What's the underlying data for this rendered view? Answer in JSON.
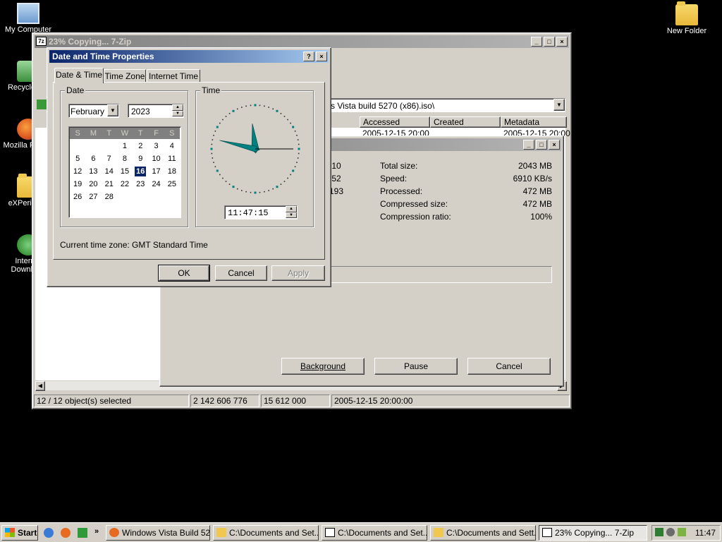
{
  "desktop": {
    "icons": [
      {
        "label": "My Computer"
      },
      {
        "label": "Recycle Bin"
      },
      {
        "label": "Mozilla Firefox"
      },
      {
        "label": "eXPerience"
      },
      {
        "label": "Internet Download"
      },
      {
        "label": "New Folder"
      }
    ]
  },
  "zip_window": {
    "title": "23% Copying... 7-Zip",
    "path": "s Vista build 5270 (x86).iso\\",
    "columns": [
      "Accessed",
      "Created",
      "Metadata Chan..."
    ],
    "row_partial": {
      "a": "2005-12-15 20:00",
      "m": "2005-12-15 20:00"
    },
    "status": [
      "12 / 12 object(s) selected",
      "2 142 606 776",
      "15 612 000",
      "2005-12-15 20:00:00"
    ]
  },
  "copy_dialog": {
    "left_values": [
      ":10",
      ":52",
      "193"
    ],
    "stats": [
      {
        "label": "Total size:",
        "value": "2043 MB"
      },
      {
        "label": "Speed:",
        "value": "6910 KB/s"
      },
      {
        "label": "Processed:",
        "value": "472 MB"
      },
      {
        "label": "Compressed size:",
        "value": "472 MB"
      },
      {
        "label": "Compression ratio:",
        "value": "100%"
      }
    ],
    "buttons": {
      "background": "Background",
      "pause": "Pause",
      "cancel": "Cancel"
    }
  },
  "datetime": {
    "title": "Date and Time Properties",
    "tabs": [
      "Date & Time",
      "Time Zone",
      "Internet Time"
    ],
    "date_group": "Date",
    "time_group": "Time",
    "month": "February",
    "year": "2023",
    "weekdays": [
      "S",
      "M",
      "T",
      "W",
      "T",
      "F",
      "S"
    ],
    "days": [
      "",
      "",
      "",
      "1",
      "2",
      "3",
      "4",
      "5",
      "6",
      "7",
      "8",
      "9",
      "10",
      "11",
      "12",
      "13",
      "14",
      "15",
      "16",
      "17",
      "18",
      "19",
      "20",
      "21",
      "22",
      "23",
      "24",
      "25",
      "26",
      "27",
      "28"
    ],
    "selected_day": "16",
    "time": "11:47:15",
    "timezone": "Current time zone:  GMT Standard Time",
    "buttons": {
      "ok": "OK",
      "cancel": "Cancel",
      "apply": "Apply"
    },
    "clock": {
      "hour": 11,
      "minute": 47,
      "second": 15
    }
  },
  "taskbar": {
    "start": "Start",
    "buttons": [
      {
        "label": "Windows Vista Build 52..."
      },
      {
        "label": "C:\\Documents and Set..."
      },
      {
        "label": "C:\\Documents and Set..."
      },
      {
        "label": "C:\\Documents and Sett..."
      },
      {
        "label": "23% Copying... 7-Zip"
      }
    ],
    "clock": "11:47"
  }
}
